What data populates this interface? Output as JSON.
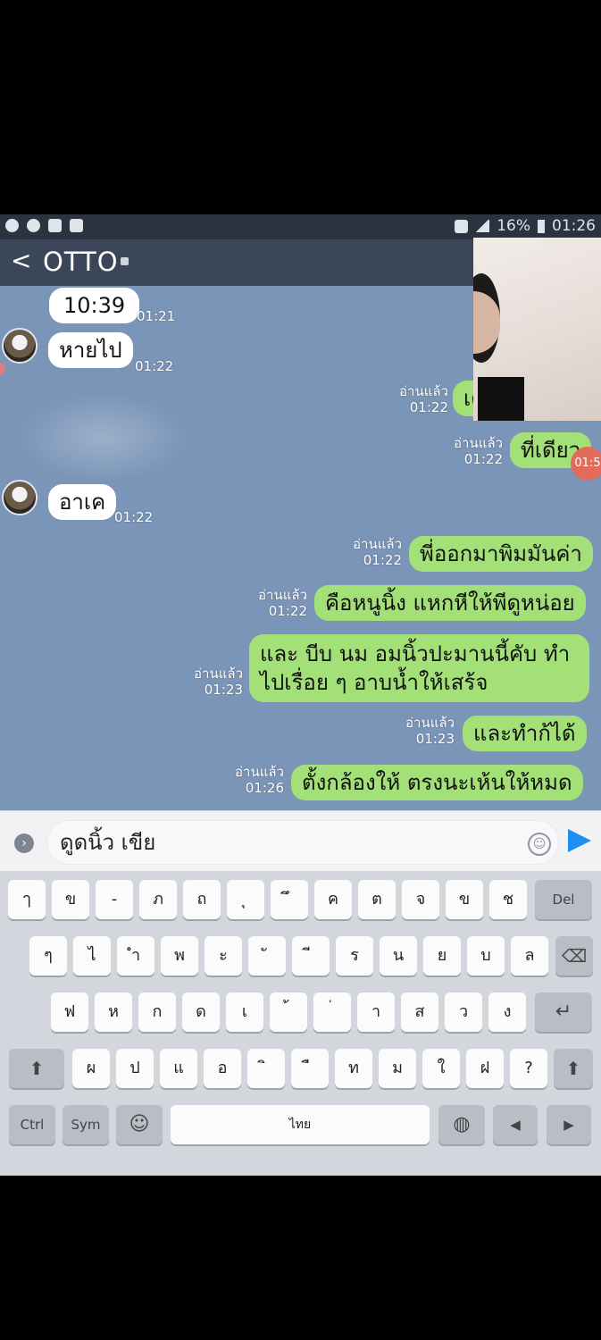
{
  "status_bar": {
    "battery": "16%",
    "time": "01:26"
  },
  "header": {
    "back_glyph": "<",
    "title": "OTTO"
  },
  "messages": [
    {
      "dir": "in",
      "text": "10:39",
      "time": "01:21"
    },
    {
      "dir": "in",
      "text": "หายไป",
      "time": "01:22"
    },
    {
      "dir": "out",
      "text": "เด",
      "read": "อ่านแล้ว",
      "time": "01:22"
    },
    {
      "dir": "out",
      "text": "ที่เดียว",
      "read": "อ่านแล้ว",
      "time": "01:22"
    },
    {
      "dir": "in",
      "text": "อาเค",
      "time": "01:22"
    },
    {
      "dir": "out",
      "text": "พี่ออกมาพิมมันค่า",
      "read": "อ่านแล้ว",
      "time": "01:22"
    },
    {
      "dir": "out",
      "text": "คือหนูนิ้ง แหกหีให้พีดูหน่อย",
      "read": "อ่านแล้ว",
      "time": "01:22"
    },
    {
      "dir": "out",
      "text_line1": "และ บีบ นม อมนิ้วปะมานนี้คับ ทำ",
      "text_line2": "ไปเรื่อย ๆ อาบน้ำให้เสร้จ",
      "read": "อ่านแล้ว",
      "time": "01:23"
    },
    {
      "dir": "out",
      "text": "และทำก้ได้",
      "read": "อ่านแล้ว",
      "time": "01:23"
    },
    {
      "dir": "out",
      "text": "ตั้งกล้องให้ ตรงนะเห้นให้หมด",
      "read": "อ่านแล้ว",
      "time": "01:26"
    }
  ],
  "video_badge": "01:5",
  "input": {
    "value": "ดูดนิ้ว เขีย"
  },
  "keyboard": {
    "row1": [
      "ๅ",
      "ข",
      "-",
      "ภ",
      "ถ",
      "ุ",
      "ึ",
      "ค",
      "ต",
      "จ",
      "ข",
      "ช",
      "Del"
    ],
    "row2": [
      "ๆ",
      "ไ",
      "ำ",
      "พ",
      "ะ",
      "ั",
      "ี",
      "ร",
      "น",
      "ย",
      "บ",
      "ล"
    ],
    "row3": [
      "ฟ",
      "ห",
      "ก",
      "ด",
      "เ",
      "้",
      "่",
      "า",
      "ส",
      "ว",
      "ง"
    ],
    "row4": [
      "ผ",
      "ป",
      "แ",
      "อ",
      "ิ",
      "ื",
      "ท",
      "ม",
      "ใ",
      "ฝ",
      "?"
    ],
    "row5": {
      "ctrl": "Ctrl",
      "sym": "Sym",
      "lang": "ไทย"
    },
    "icons": {
      "backspace": "⌫",
      "enter": "↵",
      "shift": "⬆",
      "smile": "☺",
      "left": "◀",
      "right": "▶",
      "globe": "◍"
    }
  }
}
